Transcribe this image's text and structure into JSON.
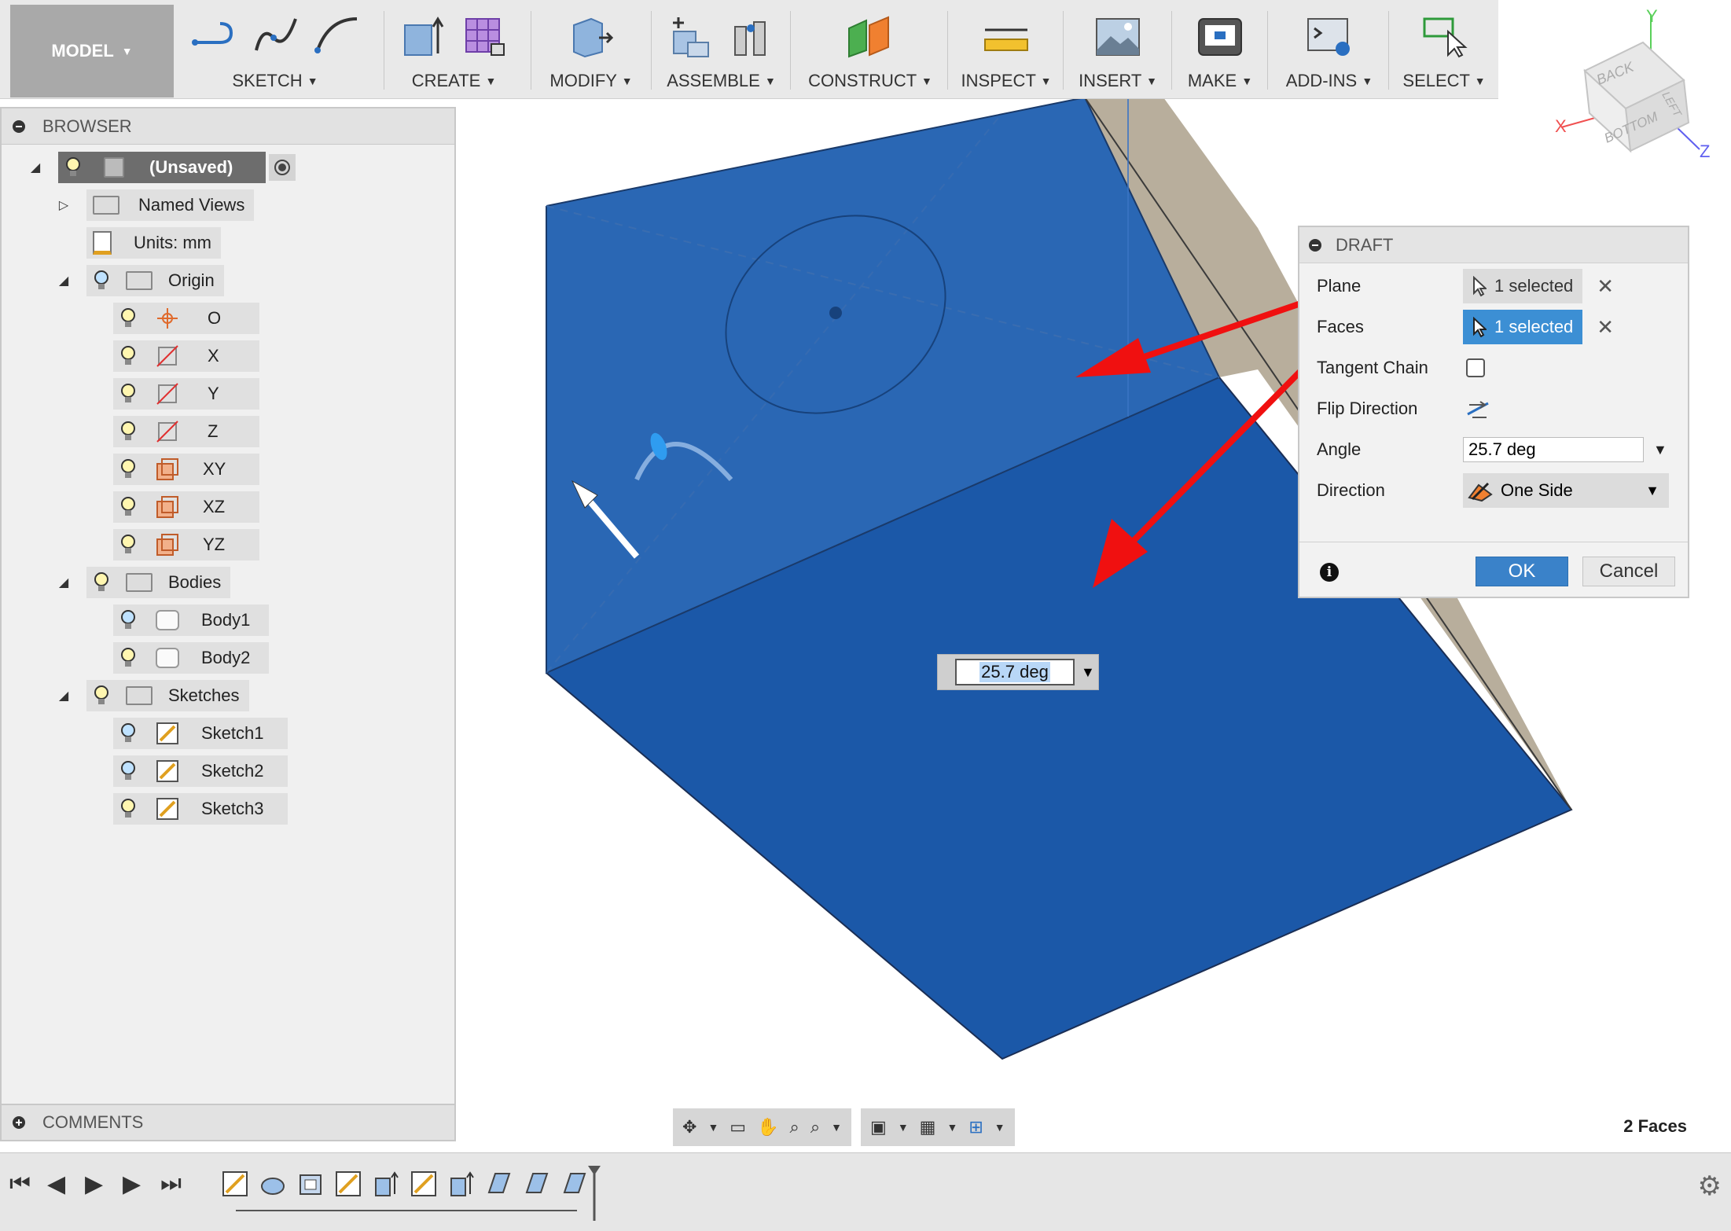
{
  "toolbar": {
    "workspace": "MODEL",
    "groups": [
      {
        "label": "SKETCH"
      },
      {
        "label": "CREATE"
      },
      {
        "label": "MODIFY"
      },
      {
        "label": "ASSEMBLE"
      },
      {
        "label": "CONSTRUCT"
      },
      {
        "label": "INSPECT"
      },
      {
        "label": "INSERT"
      },
      {
        "label": "MAKE"
      },
      {
        "label": "ADD-INS"
      },
      {
        "label": "SELECT"
      }
    ]
  },
  "browser": {
    "title": "BROWSER",
    "root": "(Unsaved)",
    "named_views": "Named Views",
    "units": "Units: mm",
    "origin": "Origin",
    "origin_items": [
      "O",
      "X",
      "Y",
      "Z",
      "XY",
      "XZ",
      "YZ"
    ],
    "bodies": "Bodies",
    "body_items": [
      "Body1",
      "Body2"
    ],
    "sketches": "Sketches",
    "sketch_items": [
      "Sketch1",
      "Sketch2",
      "Sketch3"
    ]
  },
  "comments": {
    "title": "COMMENTS"
  },
  "viewcube": {
    "face_back": "BACK",
    "face_bottom": "BOTTOM",
    "face_left": "LEFT",
    "axis_x": "X",
    "axis_y": "Y",
    "axis_z": "Z"
  },
  "draft": {
    "title": "DRAFT",
    "plane_label": "Plane",
    "plane_value": "1 selected",
    "faces_label": "Faces",
    "faces_value": "1 selected",
    "tangent_label": "Tangent Chain",
    "flip_label": "Flip Direction",
    "angle_label": "Angle",
    "angle_value": "25.7 deg",
    "direction_label": "Direction",
    "direction_value": "One Side",
    "ok_label": "OK",
    "cancel_label": "Cancel"
  },
  "float_angle": {
    "value": "25.7 deg"
  },
  "status": {
    "faces_count": "2 Faces"
  },
  "colors": {
    "face_blue": "#1f5fae",
    "face_blue_light": "#2a67b4",
    "side_tan": "#b8ae9c",
    "arrow_red": "#f01010",
    "accent": "#3c8fd4"
  }
}
